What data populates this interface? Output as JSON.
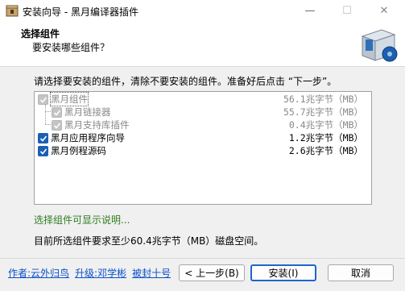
{
  "window": {
    "title": "安装向导 - 黑月编译器插件",
    "min_glyph": "—",
    "max_glyph": "☐",
    "close_glyph": "✕"
  },
  "header": {
    "title": "选择组件",
    "subtitle": "要安装哪些组件？"
  },
  "instruction": "请选择要安装的组件，清除不要安装的组件。准备好后点击 “下一步”。",
  "components": [
    {
      "label": "黑月组件",
      "size": "56.1兆字节（MB）",
      "checked": true,
      "disabled": true,
      "level": 0
    },
    {
      "label": "黑月链接器",
      "size": "55.7兆字节（MB）",
      "checked": true,
      "disabled": true,
      "level": 1
    },
    {
      "label": "黑月支持库插件",
      "size": "0.4兆字节（MB）",
      "checked": true,
      "disabled": true,
      "level": 1
    },
    {
      "label": "黑月应用程序向导",
      "size": "1.2兆字节（MB）",
      "checked": true,
      "disabled": false,
      "level": 0
    },
    {
      "label": "黑月例程源码",
      "size": "2.6兆字节（MB）",
      "checked": true,
      "disabled": false,
      "level": 0
    }
  ],
  "description": "选择组件可显示说明...",
  "space_required": "目前所选组件要求至少60.4兆字节（MB）磁盘空间。",
  "footer_links": {
    "author": "作者:云外归鸟",
    "upgrade": "升级:邓学彬",
    "packager": "被封十号"
  },
  "buttons": {
    "back": "< 上一步(B)",
    "install": "安装(I)",
    "cancel": "取消"
  },
  "colors": {
    "accent": "#1e66c8",
    "link": "#0a50c8",
    "desc_green": "#2f7d1e"
  }
}
